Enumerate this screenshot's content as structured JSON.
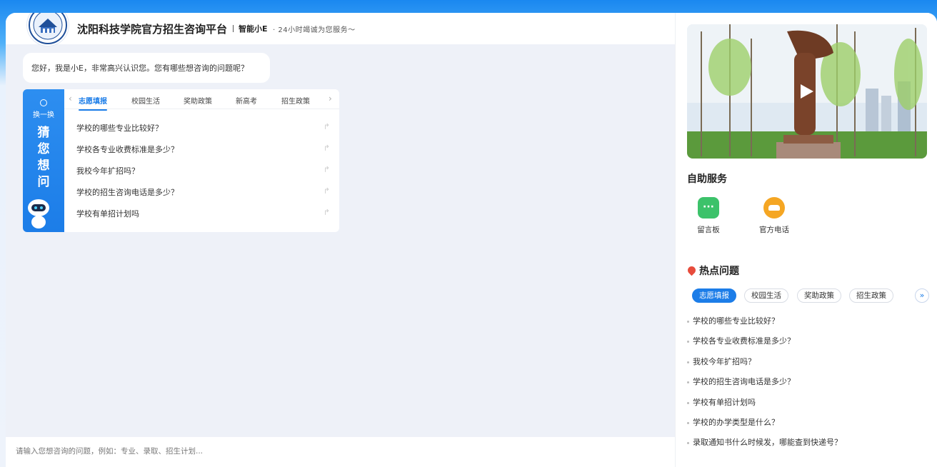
{
  "header": {
    "title": "沈阳科技学院官方招生咨询平台",
    "brand": "智能小E",
    "slogan": "· 24小时竭诚为您服务～"
  },
  "chat": {
    "greeting": "您好，我是小E，非常高兴认识您。您有哪些想咨询的问题呢？"
  },
  "guess": {
    "refresh_label": "换一换",
    "vertical_title": [
      "猜",
      "您",
      "想",
      "问"
    ],
    "tabs": [
      {
        "label": "志愿填报",
        "active": true
      },
      {
        "label": "校园生活",
        "active": false
      },
      {
        "label": "奖助政策",
        "active": false
      },
      {
        "label": "新高考",
        "active": false
      },
      {
        "label": "招生政策",
        "active": false
      }
    ],
    "questions": [
      "学校的哪些专业比较好？",
      "学校各专业收费标准是多少？",
      "我校今年扩招吗？",
      "学校的招生咨询电话是多少？",
      "学校有单招计划吗"
    ]
  },
  "input": {
    "placeholder": "请输入您想咨询的问题，例如：专业、录取、招生计划..."
  },
  "sidebar": {
    "self_service_title": "自助服务",
    "services": [
      {
        "label": "留言板",
        "icon": "message-board-icon",
        "color": "#3cc26a"
      },
      {
        "label": "官方电话",
        "icon": "phone-icon",
        "color": "#f5a623"
      }
    ],
    "hot_title": "热点问题",
    "hot_tabs": [
      {
        "label": "志愿填报",
        "active": true
      },
      {
        "label": "校园生活",
        "active": false
      },
      {
        "label": "奖助政策",
        "active": false
      },
      {
        "label": "招生政策",
        "active": false
      }
    ],
    "hot_questions": [
      "学校的哪些专业比较好？",
      "学校各专业收费标准是多少？",
      "我校今年扩招吗？",
      "学校的招生咨询电话是多少？",
      "学校有单招计划吗",
      "学校的办学类型是什么？",
      "录取通知书什么时候发，哪能查到快递号？"
    ]
  },
  "colors": {
    "accent": "#1c7de8",
    "chat_bg": "#eef1f8",
    "hot_icon": "#e74c3c"
  }
}
